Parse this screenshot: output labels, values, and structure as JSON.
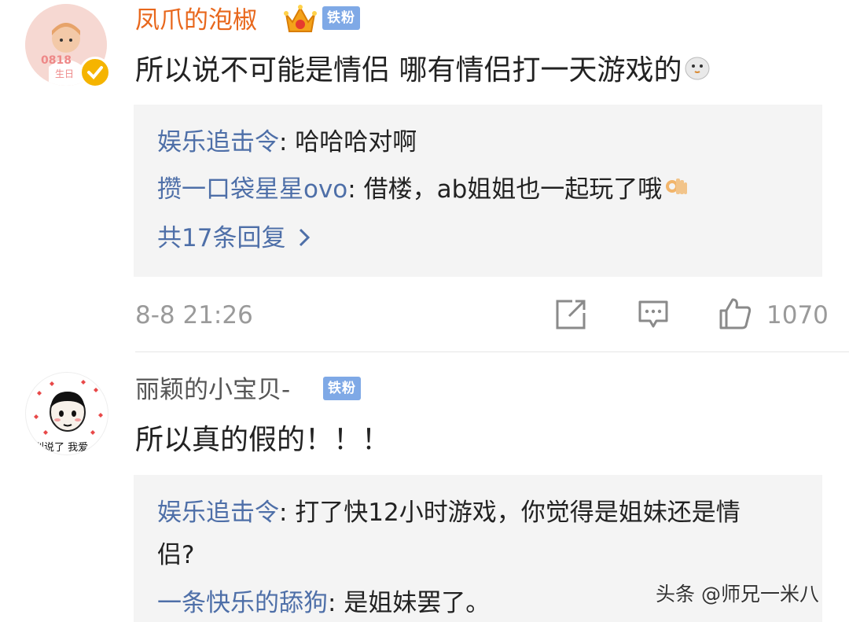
{
  "comments": [
    {
      "username": "凤爪的泡椒",
      "badge": "铁粉",
      "content": "所以说不可能是情侣  哪有情侣打一天游戏的",
      "avatar_text_1": "0818",
      "avatar_text_2": "生日",
      "replies": [
        {
          "name": "娱乐追击令",
          "text": ": 哈哈哈对啊"
        },
        {
          "name": "攒一口袋星星ovo",
          "text": ": 借楼，ab姐姐也一起玩了哦"
        }
      ],
      "more_replies": "共17条回复 ",
      "time": "8-8 21:26",
      "likes": "1070"
    },
    {
      "username": "丽颖的小宝贝-",
      "badge": "铁粉",
      "content": "所以真的假的！！！",
      "avatar_text": "别说了   我爱",
      "replies": [
        {
          "name": "娱乐追击令",
          "text": ": 打了快12小时游戏，你觉得是姐妹还是情"
        },
        {
          "name": "",
          "text": "侣?"
        },
        {
          "name": "一条快乐的舔狗",
          "text": ": 是姐妹罢了。"
        }
      ]
    }
  ],
  "watermark": "头条 @师兄一米八",
  "colors": {
    "username_highlight": "#e8671c",
    "link": "#4e6fa8",
    "badge": "#7fa9e6",
    "meta": "#9a9a9a"
  }
}
